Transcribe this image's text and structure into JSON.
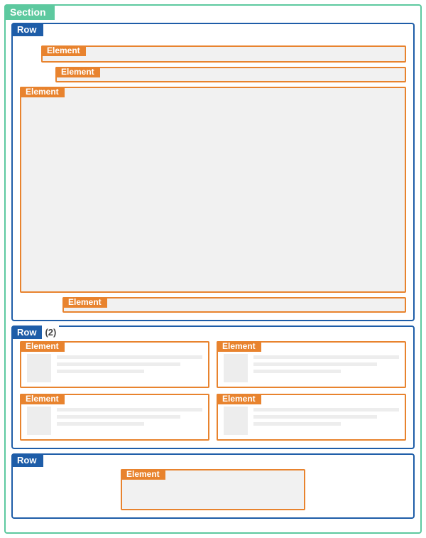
{
  "section": {
    "label": "Section"
  },
  "rows": [
    {
      "label": "Row",
      "suffix": "",
      "elements": [
        {
          "label": "Element"
        },
        {
          "label": "Element"
        },
        {
          "label": "Element"
        },
        {
          "label": "Element"
        }
      ]
    },
    {
      "label": "Row",
      "suffix": "(2)",
      "elements": [
        {
          "label": "Element"
        },
        {
          "label": "Element"
        },
        {
          "label": "Element"
        },
        {
          "label": "Element"
        }
      ]
    },
    {
      "label": "Row",
      "suffix": "",
      "elements": [
        {
          "label": "Element"
        }
      ]
    }
  ]
}
